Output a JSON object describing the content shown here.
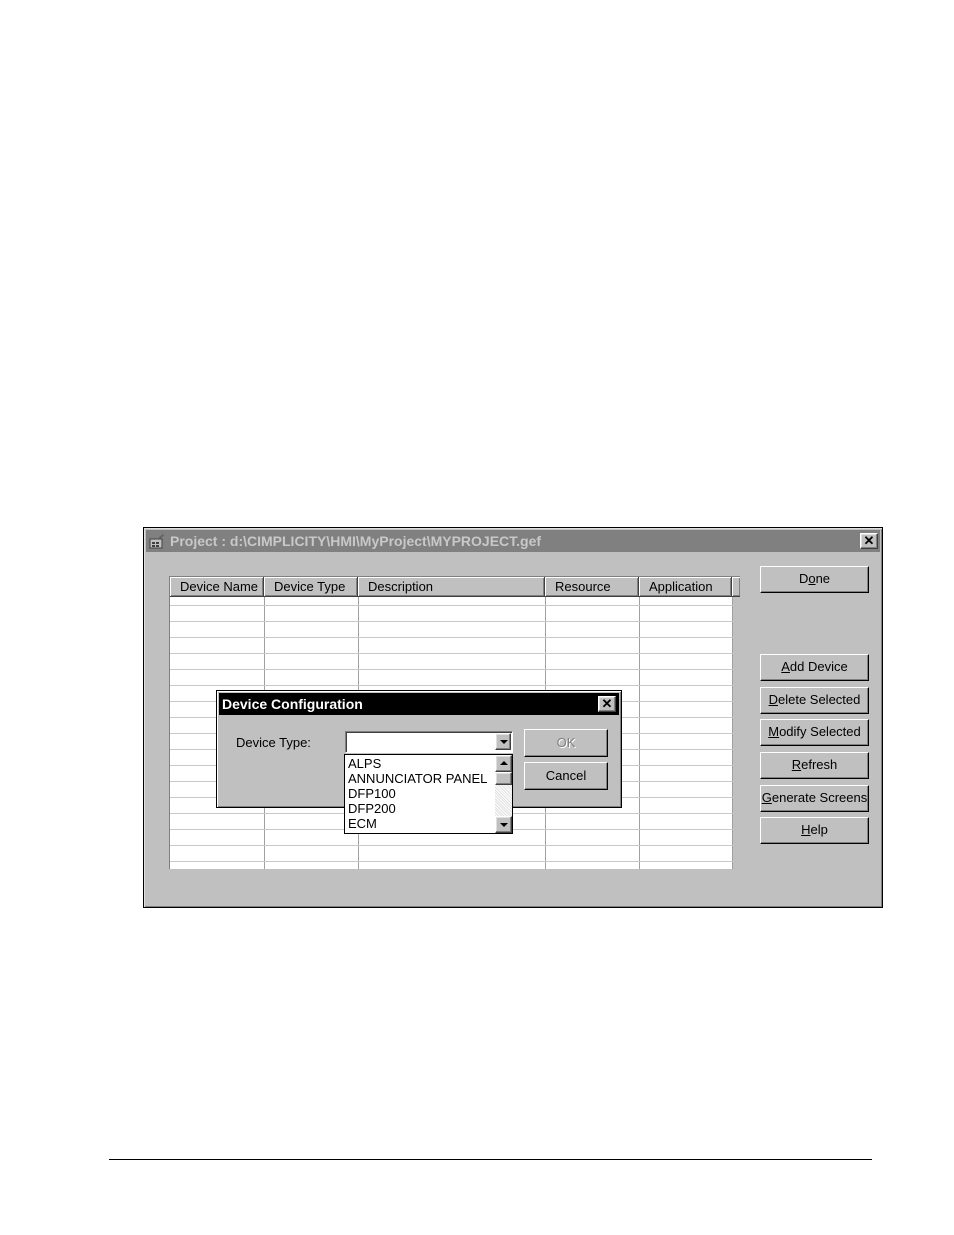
{
  "project_window": {
    "title": "Project : d:\\CIMPLICITY\\HMI\\MyProject\\MYPROJECT.gef",
    "close_label": "✕",
    "grid": {
      "columns": [
        "Device Name",
        "Device Type",
        "Description",
        "Resource",
        "Application"
      ],
      "rows": []
    },
    "buttons": {
      "done": "Done",
      "add_device": "Add Device",
      "delete_selected": "Delete Selected",
      "modify_selected": "Modify Selected",
      "refresh": "Refresh",
      "generate_screens": "Generate Screens",
      "help": "Help"
    }
  },
  "device_dialog": {
    "title": "Device Configuration",
    "close_label": "✕",
    "device_type_label": "Device Type:",
    "device_type_value": "",
    "ok_label": "OK",
    "cancel_label": "Cancel",
    "device_type_options": [
      "ALPS",
      "ANNUNCIATOR PANEL",
      "DFP100",
      "DFP200",
      "ECM"
    ]
  }
}
